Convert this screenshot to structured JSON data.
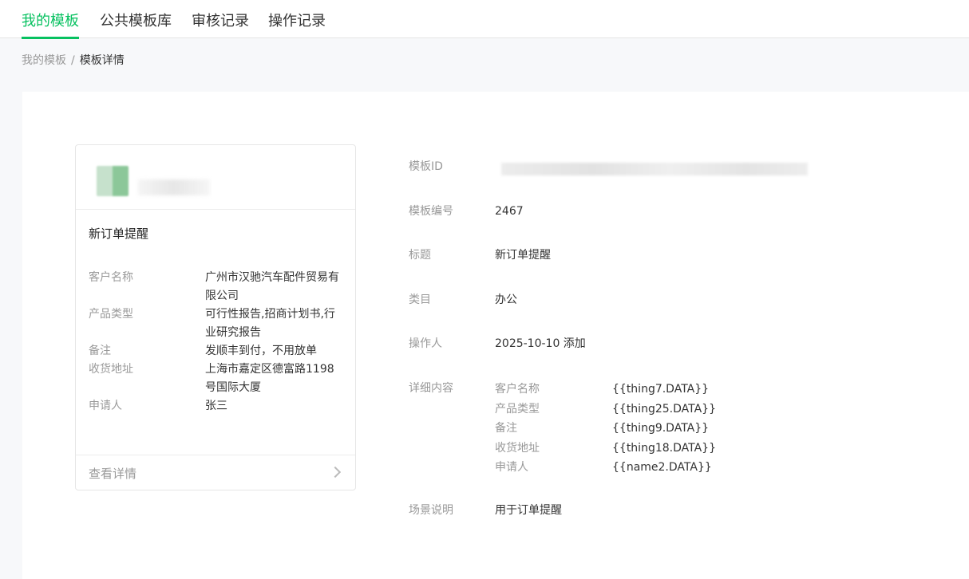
{
  "tabs": [
    {
      "label": "我的模板",
      "active": true
    },
    {
      "label": "公共模板库",
      "active": false
    },
    {
      "label": "审核记录",
      "active": false
    },
    {
      "label": "操作记录",
      "active": false
    }
  ],
  "breadcrumb": {
    "parent": "我的模板",
    "separator": "/",
    "current": "模板详情"
  },
  "card": {
    "title": "新订单提醒",
    "fields": [
      {
        "label": "客户名称",
        "value": "广州市汉驰汽车配件贸易有限公司"
      },
      {
        "label": "产品类型",
        "value": "可行性报告,招商计划书,行业研究报告"
      },
      {
        "label": "备注",
        "value": "发顺丰到付，不用放单"
      },
      {
        "label": "收货地址",
        "value": "上海市嘉定区德富路1198号国际大厦"
      },
      {
        "label": "申请人",
        "value": "张三"
      }
    ],
    "footer_link": "查看详情"
  },
  "details": {
    "template_id_label": "模板ID",
    "number_label": "模板编号",
    "number_value": "2467",
    "title_label": "标题",
    "title_value": "新订单提醒",
    "category_label": "类目",
    "category_value": "办公",
    "operator_label": "操作人",
    "operator_value": "2025-10-10 添加",
    "content_label": "详细内容",
    "content_fields": [
      {
        "label": "客户名称",
        "value": "{{thing7.DATA}}"
      },
      {
        "label": "产品类型",
        "value": "{{thing25.DATA}}"
      },
      {
        "label": "备注",
        "value": "{{thing9.DATA}}"
      },
      {
        "label": "收货地址",
        "value": "{{thing18.DATA}}"
      },
      {
        "label": "申请人",
        "value": "{{name2.DATA}}"
      }
    ],
    "scene_label": "场景说明",
    "scene_value": "用于订单提醒"
  },
  "colors": {
    "accent": "#07c160",
    "muted": "#999999",
    "text": "#333333"
  },
  "icons": {
    "footer_arrow": "chevron-right-icon"
  }
}
